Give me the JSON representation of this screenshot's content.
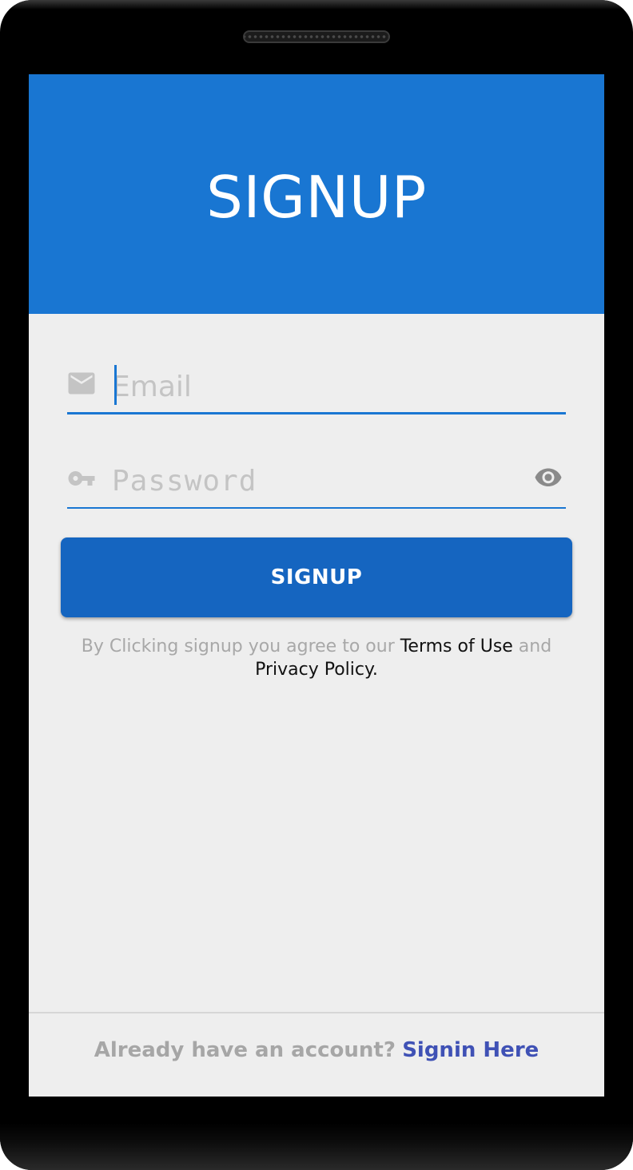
{
  "header": {
    "title": "SIGNUP"
  },
  "form": {
    "email": {
      "placeholder": "Email",
      "value": "",
      "icon": "mail-icon"
    },
    "password": {
      "placeholder": "Password",
      "value": "",
      "icon": "key-icon",
      "toggle_icon": "eye-icon"
    },
    "submit_label": "SIGNUP"
  },
  "terms": {
    "prefix": "By Clicking signup you agree to our ",
    "terms_link": "Terms of Use",
    "middle": " and",
    "privacy_link": "Privacy Policy."
  },
  "footer": {
    "question": "Already have an account?",
    "link": "Signin Here"
  },
  "colors": {
    "primary": "#1976d2",
    "button": "#1565c0",
    "background": "#eeeeee",
    "link": "#3f51b5",
    "muted_text": "#a8a8a8"
  }
}
